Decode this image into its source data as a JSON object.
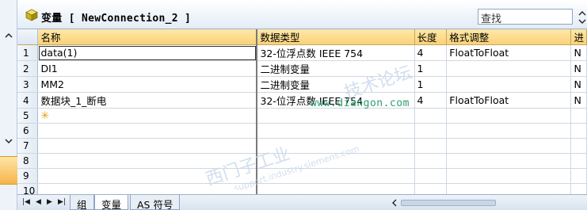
{
  "window": {
    "title": "变量 [ NewConnection_2 ]",
    "search_placeholder": "查找"
  },
  "columns": [
    "名称",
    "数据类型",
    "长度",
    "格式调整",
    "进"
  ],
  "rows": [
    {
      "num": "1",
      "name": "data(1)",
      "type": "32-位浮点数 IEEE 754",
      "length": "4",
      "format": "FloatToFloat",
      "extra": "N"
    },
    {
      "num": "2",
      "name": "DI1",
      "type": "二进制变量",
      "length": "1",
      "format": "",
      "extra": "N"
    },
    {
      "num": "3",
      "name": "MM2",
      "type": "二进制变量",
      "length": "1",
      "format": "",
      "extra": "N"
    },
    {
      "num": "4",
      "name": "数据块_1_断电",
      "type": "32-位浮点数 IEEE 754",
      "length": "4",
      "format": "FloatToFloat",
      "extra": "N"
    },
    {
      "num": "5",
      "name": "",
      "type": "",
      "length": "",
      "format": "",
      "extra": ""
    },
    {
      "num": "6",
      "name": "",
      "type": "",
      "length": "",
      "format": "",
      "extra": ""
    },
    {
      "num": "7",
      "name": "",
      "type": "",
      "length": "",
      "format": "",
      "extra": ""
    },
    {
      "num": "8",
      "name": "",
      "type": "",
      "length": "",
      "format": "",
      "extra": ""
    },
    {
      "num": "9",
      "name": "",
      "type": "",
      "length": "",
      "format": "",
      "extra": ""
    },
    {
      "num": "10",
      "name": "",
      "type": "",
      "length": "",
      "format": "",
      "extra": ""
    }
  ],
  "new_row_marker": "✳",
  "tabs": [
    "组",
    "变量",
    "AS 符号"
  ],
  "active_tab": "变量",
  "icons": {
    "title": "cube-icon",
    "nav": [
      "first-icon",
      "prev-icon",
      "next-icon",
      "last-icon"
    ]
  },
  "watermark": {
    "line1": "西门子工业",
    "line2": "support.industry.siemens.com",
    "line3": "技术论坛",
    "url": "www.diangon.com"
  },
  "colors": {
    "header_bg": "#f9d27a",
    "row_header_bg": "#e2eaf3",
    "grid_line": "#d0d7e2",
    "new_row_star": "#e0a000"
  }
}
